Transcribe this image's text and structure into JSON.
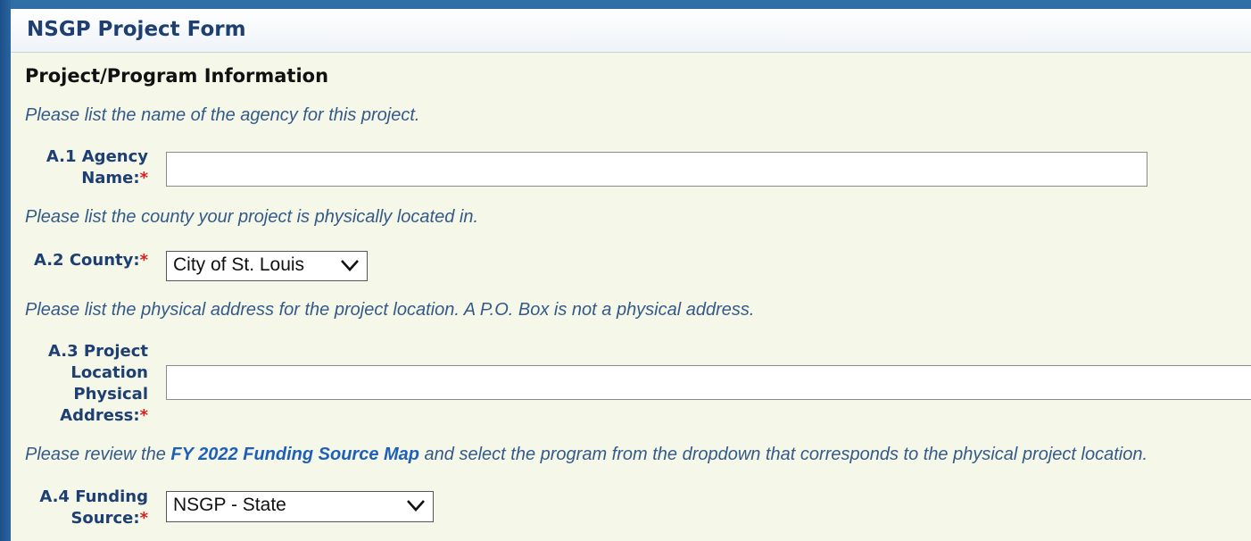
{
  "header": {
    "title": "NSGP Project Form"
  },
  "section": {
    "title": "Project/Program Information"
  },
  "a1": {
    "instruction": "Please list the name of the agency for this project.",
    "label_line1": "A.1 Agency",
    "label_line2": "Name:",
    "required": "*",
    "value": ""
  },
  "a2": {
    "instruction": "Please list the county your project is physically located in.",
    "label": "A.2 County:",
    "required": "*",
    "selected": "City of St. Louis"
  },
  "a3": {
    "instruction": "Please list the physical address for the project location. A P.O. Box is not a physical address.",
    "label_line1": "A.3 Project",
    "label_line2": "Location",
    "label_line3": "Physical",
    "label_line4": "Address:",
    "required": "*",
    "value": ""
  },
  "a4": {
    "instruction_pre": "Please review the ",
    "instruction_link": "FY 2022 Funding Source Map",
    "instruction_post": " and select the program from the dropdown that corresponds to the physical project location.",
    "label_line1": "A.4 Funding",
    "label_line2": "Source:",
    "required": "*",
    "selected": "NSGP - State"
  }
}
